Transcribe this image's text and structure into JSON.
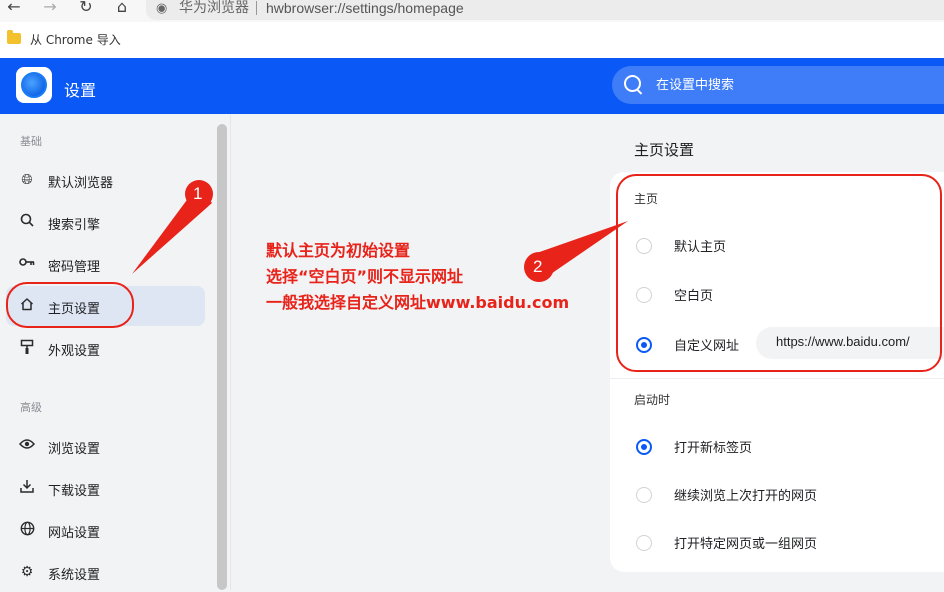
{
  "browser": {
    "nav_icons": [
      "back-arrow-icon",
      "forward-arrow-icon",
      "reload-icon",
      "home-icon"
    ],
    "site_icon": "globe-icon",
    "brand": "华为浏览器",
    "url": "hwbrowser://settings/homepage"
  },
  "bookmarks": {
    "folder_icon": "folder-icon",
    "label": "从 Chrome 导入"
  },
  "header": {
    "title": "设置",
    "search_placeholder": "在设置中搜索",
    "accent_color": "#0a59f7"
  },
  "sidebar": {
    "basic_label": "基础",
    "basic_items": [
      {
        "label": "默认浏览器",
        "icon": "globe-icon"
      },
      {
        "label": "搜索引擎",
        "icon": "search-icon"
      },
      {
        "label": "密码管理",
        "icon": "key-icon"
      },
      {
        "label": "主页设置",
        "icon": "home-icon",
        "active": true
      },
      {
        "label": "外观设置",
        "icon": "paint-brush-icon"
      }
    ],
    "advanced_label": "高级",
    "advanced_items": [
      {
        "label": "浏览设置",
        "icon": "eye-icon"
      },
      {
        "label": "下载设置",
        "icon": "download-icon"
      },
      {
        "label": "网站设置",
        "icon": "globe-icon"
      },
      {
        "label": "系统设置",
        "icon": "gear-icon"
      }
    ]
  },
  "main": {
    "title": "主页设置",
    "homepage": {
      "label": "主页",
      "options": [
        "默认主页",
        "空白页",
        "自定义网址"
      ],
      "selected": "自定义网址",
      "custom_url": "https://www.baidu.com/"
    },
    "startup": {
      "label": "启动时",
      "options": [
        "打开新标签页",
        "继续浏览上次打开的网页",
        "打开特定网页或一组网页"
      ],
      "selected": "打开新标签页"
    }
  },
  "annotations": {
    "lines": [
      "默认主页为初始设置",
      "选择“空白页”则不显示网址",
      "一般我选择自定义网址www.baidu.com"
    ],
    "badge_1": "1",
    "badge_2": "2",
    "color": "#e8231a"
  }
}
